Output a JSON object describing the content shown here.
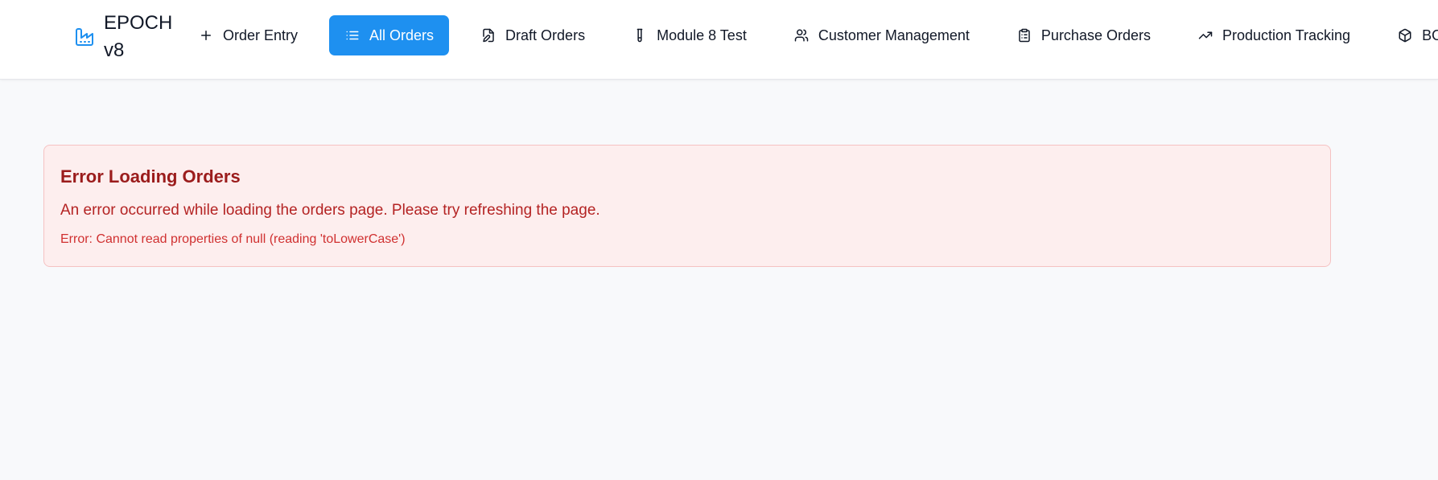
{
  "app": {
    "title": "EPOCH v8",
    "brand_icon": "factory-icon",
    "accent_color": "#1e90f0"
  },
  "nav": {
    "items": [
      {
        "label": "Order Entry",
        "icon": "plus-icon",
        "active": false
      },
      {
        "label": "All Orders",
        "icon": "list-icon",
        "active": true
      },
      {
        "label": "Draft Orders",
        "icon": "edit-document-icon",
        "active": false
      },
      {
        "label": "Module 8 Test",
        "icon": "test-tube-icon",
        "active": false
      },
      {
        "label": "Customer Management",
        "icon": "users-icon",
        "active": false
      },
      {
        "label": "Purchase Orders",
        "icon": "clipboard-icon",
        "active": false
      },
      {
        "label": "Production Tracking",
        "icon": "trending-up-icon",
        "active": false
      },
      {
        "label": "BOM",
        "icon": "package-icon",
        "active": false
      }
    ]
  },
  "error": {
    "title": "Error Loading Orders",
    "message": "An error occurred while loading the orders page. Please try refreshing the page.",
    "detail": "Error: Cannot read properties of null (reading 'toLowerCase')",
    "colors": {
      "background": "#fdeeee",
      "border": "#f5c2c2",
      "title": "#9b1c1c"
    }
  }
}
